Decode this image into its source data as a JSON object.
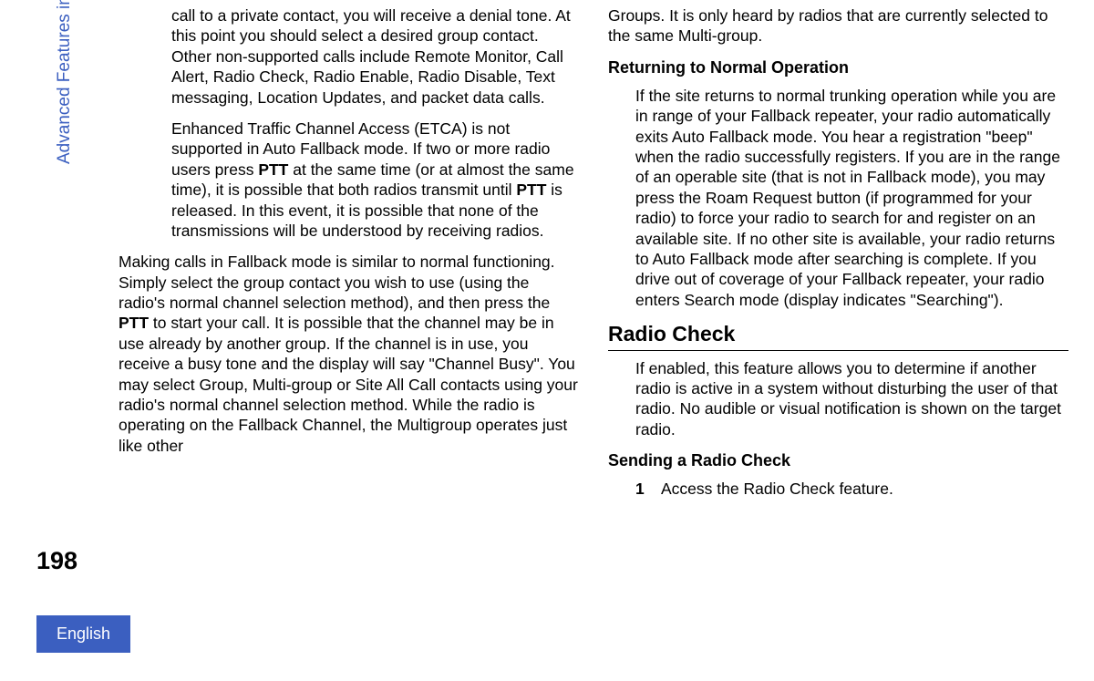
{
  "side_label": "Advanced Features in Connect Plus Mode",
  "page_number": "198",
  "language": "English",
  "col1": {
    "p1_pre": "call to a private contact, you will receive a denial tone. At this point you should select a desired group contact. Other non-supported calls include Remote Monitor, Call Alert, Radio Check, Radio Enable, Radio Disable, Text messaging, Location Updates, and packet data calls.",
    "p2_a": "Enhanced Traffic Channel Access (ETCA) is not supported in Auto Fallback mode. If two or more radio users press ",
    "ptt": "PTT",
    "p2_b": " at the same time (or at almost the same time), it is possible that both radios transmit until ",
    "p2_c": " is released. In this event, it is possible that none of the transmissions will be understood by receiving radios.",
    "p3_a": "Making calls in Fallback mode is similar to normal functioning. Simply select the group contact you wish to use (using the radio's normal channel selection method), and then press the ",
    "p3_b": " to start your call. It is possible that the channel may be in use already by another group. If the channel is in use, you receive a busy tone and the display will say \"Channel Busy\". You may select Group, Multi-group or Site All Call contacts using your radio's normal channel selection method. While the radio is operating on the Fallback Channel, the Multigroup operates just like other"
  },
  "col2": {
    "p1": "Groups. It is only heard by radios that are currently selected to the same Multi-group.",
    "sub1": "Returning to Normal Operation",
    "p2": "If the site returns to normal trunking operation while you are in range of your Fallback repeater, your radio automatically exits Auto Fallback mode. You hear a registration \"beep\" when the radio successfully registers. If you are in the range of an operable site (that is not in Fallback mode), you may press the Roam Request button (if programmed for your radio) to force your radio to search for and register on an available site. If no other site is available, your radio returns to Auto Fallback mode after searching is complete. If you drive out of coverage of your Fallback repeater, your radio enters Search mode (display indicates \"Searching\").",
    "h1": "Radio Check",
    "p3": "If enabled, this feature allows you to determine if another radio is active in a system without disturbing the user of that radio. No audible or visual notification is shown on the target radio.",
    "sub2": "Sending a Radio Check",
    "step1_num": "1",
    "step1_text": "Access the Radio Check feature."
  }
}
